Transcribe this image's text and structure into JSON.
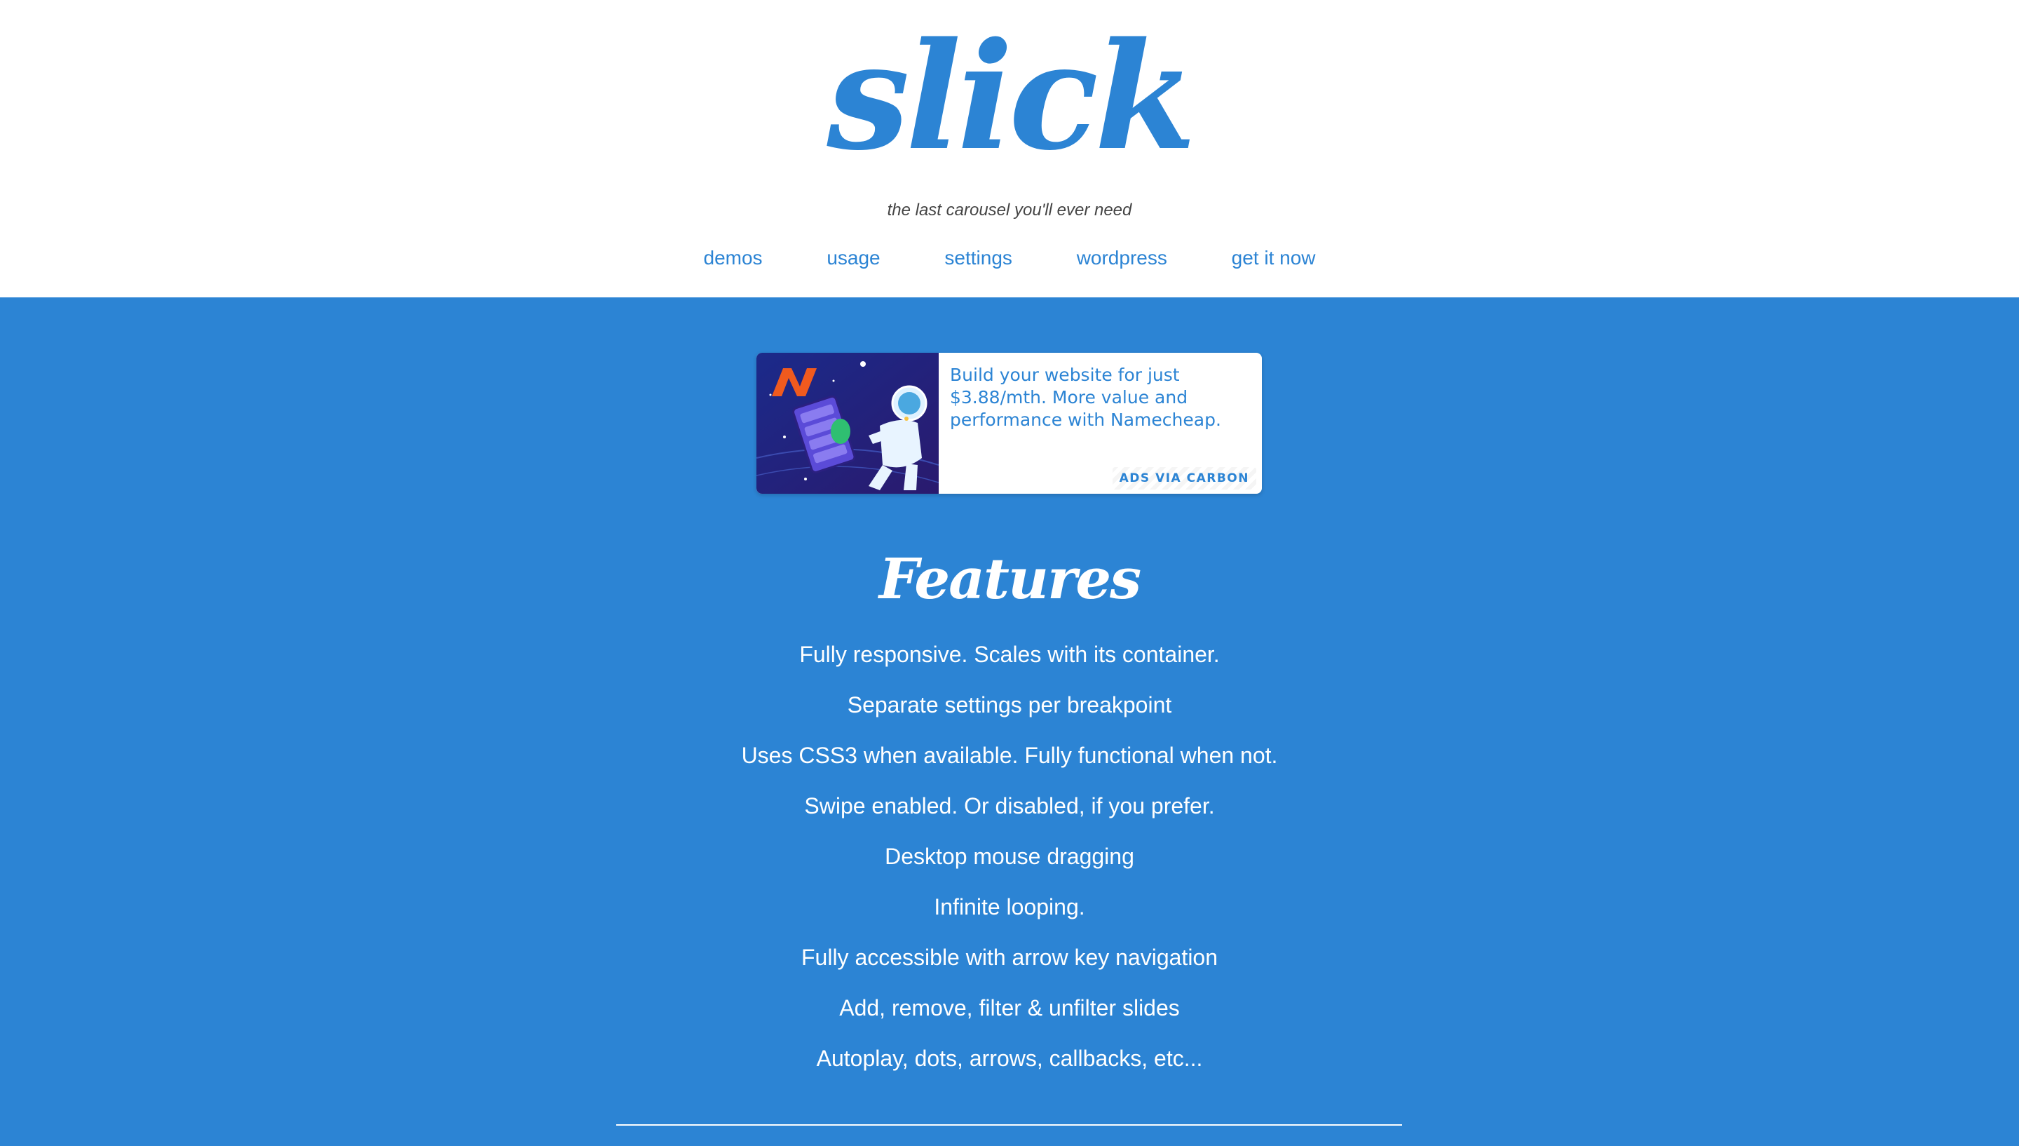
{
  "brand": {
    "logo_text": "slick",
    "tagline": "the last carousel you'll ever need",
    "color": "#2c84d4"
  },
  "nav": {
    "items": [
      {
        "label": "demos"
      },
      {
        "label": "usage"
      },
      {
        "label": "settings"
      },
      {
        "label": "wordpress"
      },
      {
        "label": "get it now"
      }
    ]
  },
  "ad": {
    "text": "Build your website for just $3.88/mth. More value and performance with Namecheap.",
    "via_label": "ADS VIA CARBON",
    "image_icon": "namecheap-astronaut-illustration"
  },
  "features": {
    "title": "Features",
    "items": [
      "Fully responsive. Scales with its container.",
      "Separate settings per breakpoint",
      "Uses CSS3 when available. Fully functional when not.",
      "Swipe enabled. Or disabled, if you prefer.",
      "Desktop mouse dragging",
      "Infinite looping.",
      "Fully accessible with arrow key navigation",
      "Add, remove, filter & unfilter slides",
      "Autoplay, dots, arrows, callbacks, etc..."
    ]
  }
}
